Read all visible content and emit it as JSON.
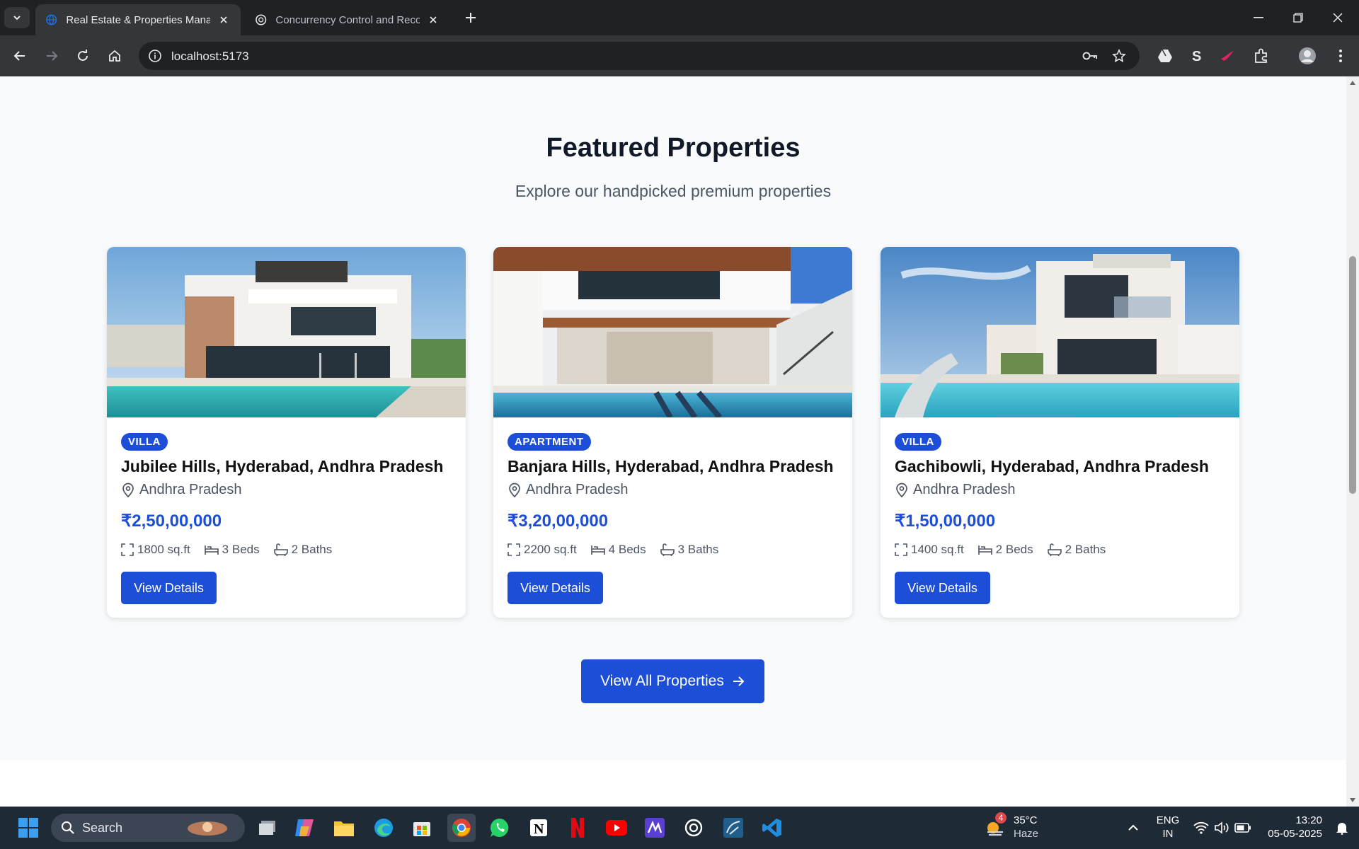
{
  "browser": {
    "tabs": [
      {
        "title": "Real Estate & Properties Manag",
        "active": true
      },
      {
        "title": "Concurrency Control and Recov",
        "active": false
      }
    ],
    "url": "localhost:5173"
  },
  "section": {
    "title": "Featured Properties",
    "subtitle": "Explore our handpicked premium properties"
  },
  "properties": [
    {
      "type": "VILLA",
      "title": "Jubilee Hills, Hyderabad, Andhra Pradesh",
      "location": "Andhra Pradesh",
      "price": "₹2,50,00,000",
      "area": "1800 sq.ft",
      "beds": "3 Beds",
      "baths": "2 Baths",
      "button": "View Details"
    },
    {
      "type": "APARTMENT",
      "title": "Banjara Hills, Hyderabad, Andhra Pradesh",
      "location": "Andhra Pradesh",
      "price": "₹3,20,00,000",
      "area": "2200 sq.ft",
      "beds": "4 Beds",
      "baths": "3 Baths",
      "button": "View Details"
    },
    {
      "type": "VILLA",
      "title": "Gachibowli, Hyderabad, Andhra Pradesh",
      "location": "Andhra Pradesh",
      "price": "₹1,50,00,000",
      "area": "1400 sq.ft",
      "beds": "2 Beds",
      "baths": "2 Baths",
      "button": "View Details"
    }
  ],
  "cta": {
    "label": "View All Properties"
  },
  "taskbar": {
    "search_label": "Search",
    "weather_badge": "4",
    "temperature": "35°C",
    "weather": "Haze",
    "lang": "ENG",
    "region": "IN",
    "time": "13:20",
    "date": "05-05-2025"
  },
  "colors": {
    "accent": "#1d4ed8",
    "page_bg": "#f8fafc",
    "chrome_bg": "#35363a"
  }
}
